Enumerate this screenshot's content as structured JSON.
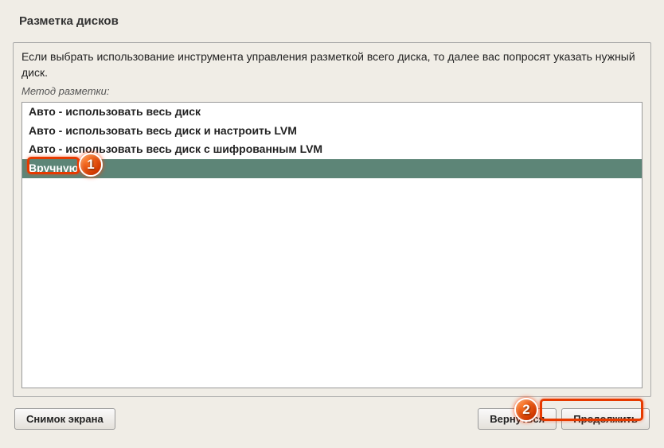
{
  "window": {
    "title": "Разметка дисков",
    "description": "Если выбрать использование инструмента управления разметкой всего диска, то далее вас попросят указать нужный диск.",
    "method_label": "Метод разметки:"
  },
  "list": {
    "items": [
      "Авто - использовать весь диск",
      "Авто - использовать весь диск и настроить LVM",
      "Авто - использовать весь диск с шифрованным LVM",
      "Вручную"
    ],
    "selected_index": 3
  },
  "buttons": {
    "screenshot": "Снимок экрана",
    "back": "Вернуться",
    "continue": "Продолжить"
  },
  "annotations": {
    "marker1": "1",
    "marker2": "2"
  }
}
